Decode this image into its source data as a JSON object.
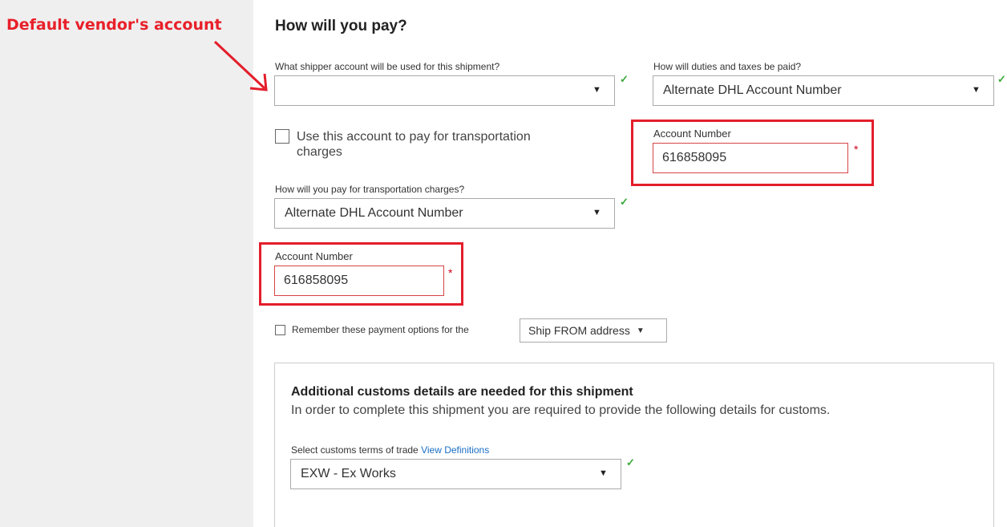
{
  "annotation": {
    "text": "Default vendor's account",
    "color": "#e41e2b"
  },
  "page": {
    "title": "How will you pay?"
  },
  "shipper_account": {
    "label": "What shipper account will be used for this shipment?",
    "value": ""
  },
  "duties": {
    "label": "How will duties and taxes be paid?",
    "value": "Alternate DHL Account Number"
  },
  "duties_account": {
    "label": "Account Number",
    "value": "616858095"
  },
  "use_account": {
    "label_line1": "Use this account to pay for transportation",
    "label_line2": "charges",
    "checked": false
  },
  "transport": {
    "label": "How will you pay for transportation charges?",
    "value": "Alternate DHL Account Number"
  },
  "transport_account": {
    "label": "Account Number",
    "value": "616858095"
  },
  "remember": {
    "label": "Remember these payment options for the",
    "select_value": "Ship FROM address",
    "checked": false
  },
  "customs": {
    "heading": "Additional customs details are needed for this shipment",
    "description": "In order to complete this shipment you are required to provide the following details for customs.",
    "terms_label": "Select customs terms of trade",
    "terms_link": "View Definitions",
    "terms_value": "EXW - Ex Works"
  },
  "icons": {
    "check": "check-icon",
    "caret": "caret-down-icon",
    "required": "required-asterisk"
  }
}
